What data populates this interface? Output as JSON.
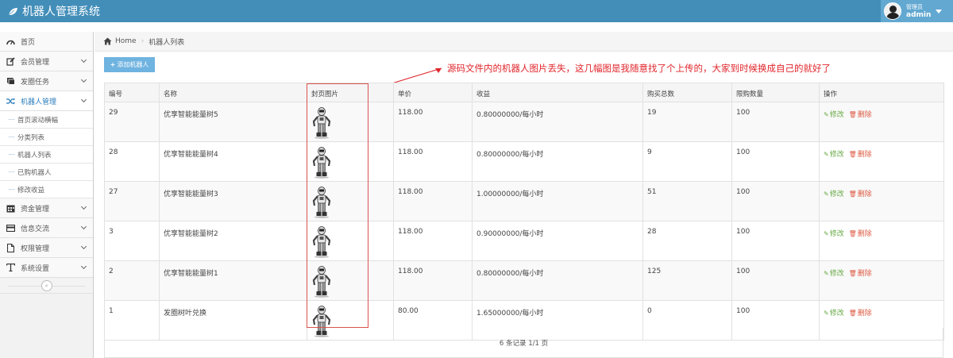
{
  "app": {
    "title": "机器人管理系统"
  },
  "user": {
    "role": "管理员",
    "name": "admin"
  },
  "sidebar": {
    "items": [
      {
        "label": "首页",
        "icon": "tachometer-icon"
      },
      {
        "label": "会员管理",
        "icon": "edit-icon"
      },
      {
        "label": "发圈任务",
        "icon": "book-icon"
      },
      {
        "label": "机器人管理",
        "icon": "random-icon",
        "active": true
      },
      {
        "label": "资金管理",
        "icon": "calendar-icon"
      },
      {
        "label": "信息交流",
        "icon": "credit-card-icon"
      },
      {
        "label": "权限管理",
        "icon": "file-icon"
      },
      {
        "label": "系统设置",
        "icon": "text-icon"
      }
    ],
    "submenu": [
      "首页滚动横幅",
      "分类列表",
      "机器人列表",
      "已购机器人",
      "修改收益"
    ],
    "collapse_label": "«"
  },
  "breadcrumb": {
    "home": "Home",
    "current": "机器人列表"
  },
  "toolbar": {
    "add_label": "添加机器人"
  },
  "annotation": "源码文件内的机器人图片丢失，这几幅图是我随意找了个上传的，大家到时候换成自己的就好了",
  "table": {
    "headers": [
      "编号",
      "名称",
      "封页图片",
      "单价",
      "收益",
      "购买总数",
      "限购数量",
      "操作"
    ],
    "rows": [
      {
        "id": "29",
        "name": "优享智能能量树5",
        "price": "118.00",
        "income": "0.80000000/每小时",
        "total": "19",
        "limit": "100"
      },
      {
        "id": "28",
        "name": "优享智能能量树4",
        "price": "118.00",
        "income": "0.80000000/每小时",
        "total": "9",
        "limit": "100"
      },
      {
        "id": "27",
        "name": "优享智能能量树3",
        "price": "118.00",
        "income": "1.00000000/每小时",
        "total": "51",
        "limit": "100"
      },
      {
        "id": "3",
        "name": "优享智能能量树2",
        "price": "118.00",
        "income": "0.90000000/每小时",
        "total": "28",
        "limit": "100"
      },
      {
        "id": "2",
        "name": "优享智能能量树1",
        "price": "118.00",
        "income": "0.80000000/每小时",
        "total": "125",
        "limit": "100"
      },
      {
        "id": "1",
        "name": "发圈树叶兑换",
        "price": "80.00",
        "income": "1.65000000/每小时",
        "total": "0",
        "limit": "100"
      }
    ],
    "edit_label": "修改",
    "delete_label": "删除"
  },
  "pagination": {
    "summary": "6 条记录 1/1 页"
  },
  "colors": {
    "topbar": "#438eb9",
    "user_area": "#62a8d1",
    "accent": "#2b7dbc",
    "add_button": "#6fb3e0",
    "edit": "#69aa46",
    "delete": "#dd5a43",
    "annotation": "#e0242a"
  }
}
